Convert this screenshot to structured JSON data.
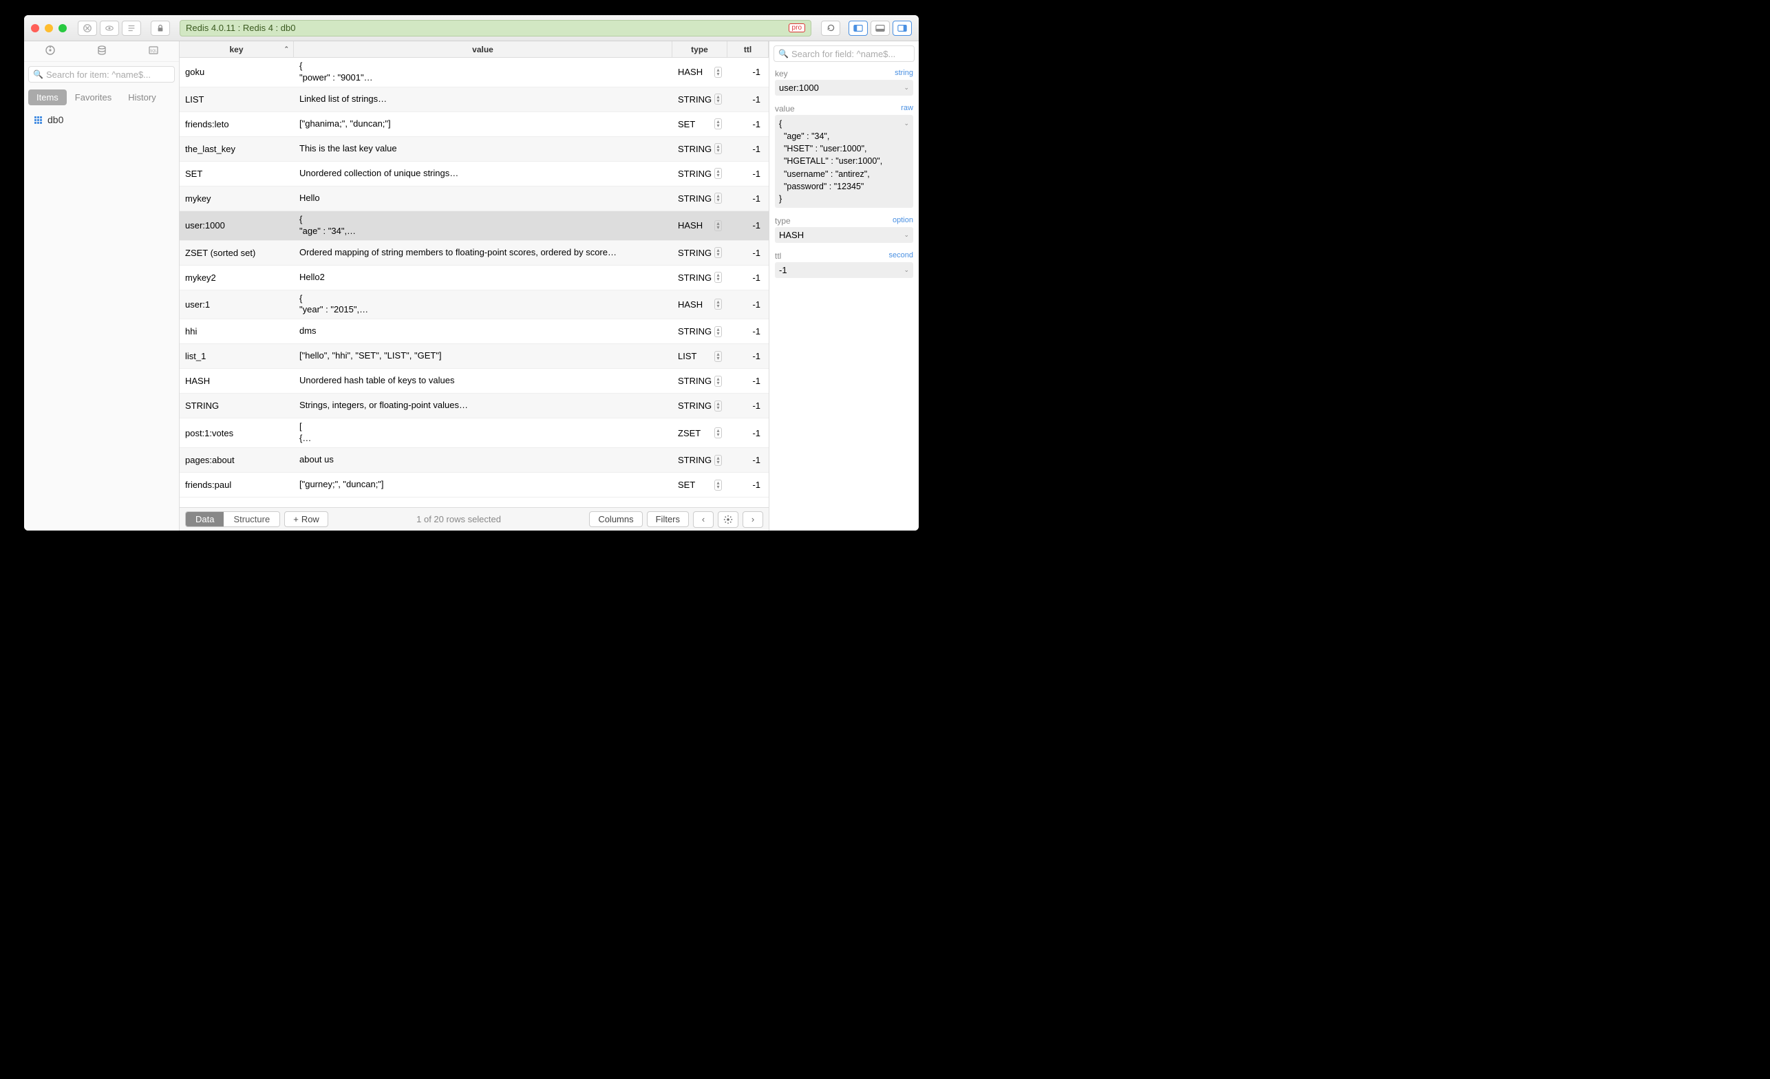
{
  "titlebar": {
    "path": "Redis 4.0.11 : Redis 4 : db0",
    "pro_badge": "pro"
  },
  "sidebar": {
    "search_placeholder": "Search for item: ^name$...",
    "tabs": {
      "items": "Items",
      "favorites": "Favorites",
      "history": "History"
    },
    "db_item": "db0"
  },
  "table": {
    "headers": {
      "key": "key",
      "value": "value",
      "type": "type",
      "ttl": "ttl"
    },
    "rows": [
      {
        "key": "goku",
        "value": "{\n  \"power\" : \"9001\"…",
        "type": "HASH",
        "ttl": "-1"
      },
      {
        "key": "LIST",
        "value": "Linked list of strings…",
        "type": "STRING",
        "ttl": "-1"
      },
      {
        "key": "friends:leto",
        "value": "[\"ghanima;\", \"duncan;\"]",
        "type": "SET",
        "ttl": "-1"
      },
      {
        "key": "the_last_key",
        "value": "This is the last key value",
        "type": "STRING",
        "ttl": "-1"
      },
      {
        "key": "SET",
        "value": "Unordered collection of unique strings…",
        "type": "STRING",
        "ttl": "-1"
      },
      {
        "key": "mykey",
        "value": "Hello",
        "type": "STRING",
        "ttl": "-1"
      },
      {
        "key": "user:1000",
        "value": "{\n  \"age\" : \"34\",…",
        "type": "HASH",
        "ttl": "-1",
        "selected": true
      },
      {
        "key": "ZSET (sorted set)",
        "value": "Ordered mapping of string members to floating-point scores, ordered by score…",
        "type": "STRING",
        "ttl": "-1"
      },
      {
        "key": "mykey2",
        "value": "Hello2",
        "type": "STRING",
        "ttl": "-1"
      },
      {
        "key": "user:1",
        "value": "{\n  \"year\" : \"2015\",…",
        "type": "HASH",
        "ttl": "-1"
      },
      {
        "key": "hhi",
        "value": "dms",
        "type": "STRING",
        "ttl": "-1"
      },
      {
        "key": "list_1",
        "value": "[\"hello\", \"hhi\", \"SET\", \"LIST\", \"GET\"]",
        "type": "LIST",
        "ttl": "-1"
      },
      {
        "key": "HASH",
        "value": "Unordered hash table of keys to values",
        "type": "STRING",
        "ttl": "-1"
      },
      {
        "key": "STRING",
        "value": "Strings, integers, or floating-point values…",
        "type": "STRING",
        "ttl": "-1"
      },
      {
        "key": "post:1:votes",
        "value": "[\n  {…",
        "type": "ZSET",
        "ttl": "-1"
      },
      {
        "key": "pages:about",
        "value": "about us",
        "type": "STRING",
        "ttl": "-1"
      },
      {
        "key": "friends:paul",
        "value": "[\"gurney;\", \"duncan;\"]",
        "type": "SET",
        "ttl": "-1"
      }
    ]
  },
  "footer": {
    "data": "Data",
    "structure": "Structure",
    "row": "Row",
    "status": "1 of 20 rows selected",
    "columns": "Columns",
    "filters": "Filters"
  },
  "inspector": {
    "search_placeholder": "Search for field: ^name$...",
    "key_label": "key",
    "key_hint": "string",
    "key_value": "user:1000",
    "value_label": "value",
    "value_hint": "raw",
    "value_text": "{\n  \"age\" : \"34\",\n  \"HSET\" : \"user:1000\",\n  \"HGETALL\" : \"user:1000\",\n  \"username\" : \"antirez\",\n  \"password\" : \"12345\"\n}",
    "type_label": "type",
    "type_hint": "option",
    "type_value": "HASH",
    "ttl_label": "ttl",
    "ttl_hint": "second",
    "ttl_value": "-1"
  }
}
